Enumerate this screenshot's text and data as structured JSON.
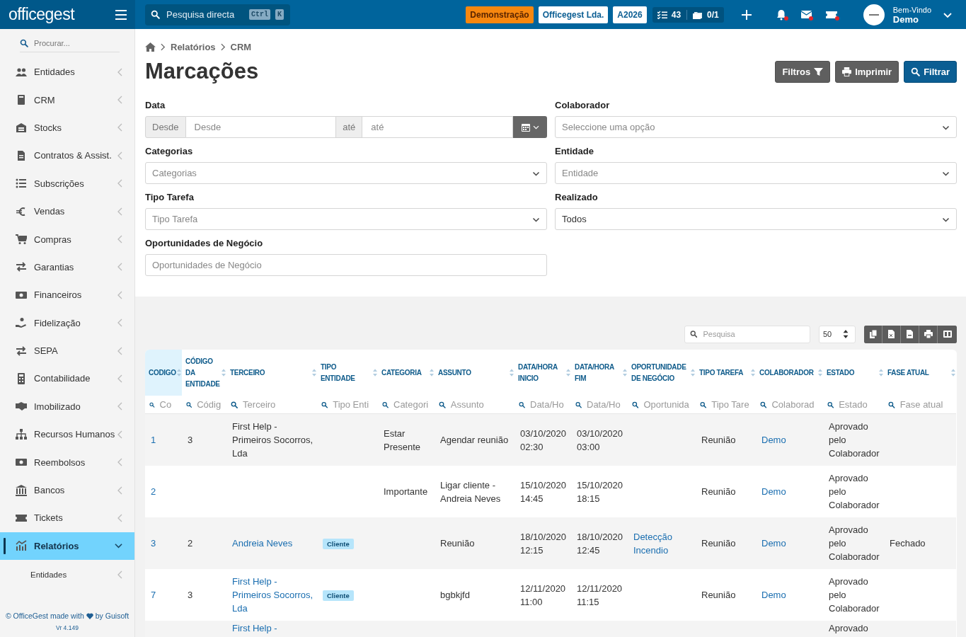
{
  "topbar": {
    "brand": "officegest",
    "search": {
      "placeholder": "Pesquisa directa",
      "keys": [
        "Ctrl",
        "K"
      ]
    },
    "badges": [
      {
        "label": "Demonstração",
        "kind": "warning"
      },
      {
        "label": "Officegest Lda.",
        "kind": "plain"
      },
      {
        "label": "A2026",
        "kind": "plain"
      }
    ],
    "counters": {
      "tasks": "43",
      "folders": "0/1"
    },
    "user": {
      "greeting": "Bem-Vindo",
      "name": "Demo"
    }
  },
  "sidebar": {
    "search": {
      "placeholder": "Procurar..."
    },
    "items": [
      {
        "label": "Entidades",
        "selected": false,
        "expanded": false
      },
      {
        "label": "CRM",
        "selected": false,
        "expanded": false
      },
      {
        "label": "Stocks",
        "selected": false,
        "expanded": false
      },
      {
        "label": "Contratos & Assist.",
        "selected": false,
        "expanded": false
      },
      {
        "label": "Subscrições",
        "selected": false,
        "expanded": false
      },
      {
        "label": "Vendas",
        "selected": false,
        "expanded": false
      },
      {
        "label": "Compras",
        "selected": false,
        "expanded": false
      },
      {
        "label": "Garantias",
        "selected": false,
        "expanded": false
      },
      {
        "label": "Financeiros",
        "selected": false,
        "expanded": false
      },
      {
        "label": "Fidelização",
        "selected": false,
        "expanded": false
      },
      {
        "label": "SEPA",
        "selected": false,
        "expanded": false
      },
      {
        "label": "Contabilidade",
        "selected": false,
        "expanded": false
      },
      {
        "label": "Imobilizado",
        "selected": false,
        "expanded": false
      },
      {
        "label": "Recursos Humanos",
        "selected": false,
        "expanded": false
      },
      {
        "label": "Reembolsos",
        "selected": false,
        "expanded": false
      },
      {
        "label": "Bancos",
        "selected": false,
        "expanded": false
      },
      {
        "label": "Tickets",
        "selected": false,
        "expanded": false
      },
      {
        "label": "Relatórios",
        "selected": true,
        "expanded": true,
        "children": [
          {
            "label": "Entidades",
            "selected": false
          }
        ]
      }
    ],
    "footer": {
      "credit": "© OfficeGest made with",
      "author": "by Guisoft",
      "version": "Vr 4.149"
    }
  },
  "breadcrumb": [
    "Relatórios",
    "CRM"
  ],
  "title": "Marcações",
  "actions": [
    {
      "label": "Filtros",
      "kind": "secondary"
    },
    {
      "label": "Imprimir",
      "kind": "secondary"
    },
    {
      "label": "Filtrar",
      "kind": "primary"
    }
  ],
  "filters": [
    {
      "kind": "daterange",
      "label": "Data",
      "from_addon": "Desde",
      "from_placeholder": "Desde",
      "to_addon": "até",
      "to_placeholder": "até"
    },
    {
      "kind": "select",
      "label": "Colaborador",
      "placeholder": "Seleccione uma opção"
    },
    {
      "kind": "select",
      "label": "Categorias",
      "placeholder": "Categorias"
    },
    {
      "kind": "select",
      "label": "Entidade",
      "placeholder": "Entidade"
    },
    {
      "kind": "select",
      "label": "Tipo Tarefa",
      "placeholder": "Tipo Tarefa"
    },
    {
      "kind": "select",
      "label": "Realizado",
      "value": "Todos"
    },
    {
      "kind": "input",
      "label": "Oportunidades de Negócio",
      "placeholder": "Oportunidades de Negócio"
    }
  ],
  "table": {
    "search": {
      "placeholder": "Pesquisa"
    },
    "page_size": "50",
    "columns": [
      {
        "label": "CODIGO",
        "placeholder": "Co",
        "selected": true
      },
      {
        "label": "CÓDIGO DA ENTIDADE",
        "placeholder": "Códig",
        "selected": false
      },
      {
        "label": "TERCEIRO",
        "placeholder": "Terceiro",
        "selected": false
      },
      {
        "label": "TIPO ENTIDADE",
        "placeholder": "Tipo Enti",
        "selected": false
      },
      {
        "label": "CATEGORIA",
        "placeholder": "Categori",
        "selected": false
      },
      {
        "label": "ASSUNTO",
        "placeholder": "Assunto",
        "selected": false
      },
      {
        "label": "DATA/HORA INICIO",
        "placeholder": "Data/Ho",
        "selected": false
      },
      {
        "label": "DATA/HORA FIM",
        "placeholder": "Data/Ho",
        "selected": false
      },
      {
        "label": "OPORTUNIDADE DE NEGÓCIO",
        "placeholder": "Oportunida",
        "selected": false
      },
      {
        "label": "TIPO TAREFA",
        "placeholder": "Tipo Tare",
        "selected": false
      },
      {
        "label": "COLABORADOR",
        "placeholder": "Colaborad",
        "selected": false
      },
      {
        "label": "ESTADO",
        "placeholder": "Estado",
        "selected": false
      },
      {
        "label": "FASE ATUAL",
        "placeholder": "Fase atual",
        "selected": false
      }
    ],
    "rows": [
      [
        {
          "kind": "link",
          "text": "1"
        },
        {
          "kind": "text",
          "text": "3"
        },
        {
          "kind": "text",
          "text": "First Help - Primeiros Socorros, Lda"
        },
        null,
        {
          "kind": "text",
          "text": "Estar Presente"
        },
        {
          "kind": "text",
          "text": "Agendar reunião"
        },
        {
          "kind": "text",
          "text": "03/10/2020 02:30"
        },
        {
          "kind": "text",
          "text": "03/10/2020 03:00"
        },
        null,
        {
          "kind": "text",
          "text": "Reunião"
        },
        {
          "kind": "link",
          "text": "Demo"
        },
        {
          "kind": "text",
          "text": "Aprovado pelo Colaborador"
        },
        null
      ],
      [
        {
          "kind": "link",
          "text": "2"
        },
        null,
        null,
        null,
        {
          "kind": "text",
          "text": "Importante"
        },
        {
          "kind": "text",
          "text": "Ligar cliente - Andreia Neves"
        },
        {
          "kind": "text",
          "text": "15/10/2020 14:45"
        },
        {
          "kind": "text",
          "text": "15/10/2020 18:15"
        },
        null,
        {
          "kind": "text",
          "text": "Reunião"
        },
        {
          "kind": "link",
          "text": "Demo"
        },
        {
          "kind": "text",
          "text": "Aprovado pelo Colaborador"
        },
        null
      ],
      [
        {
          "kind": "link",
          "text": "3"
        },
        {
          "kind": "text",
          "text": "2"
        },
        {
          "kind": "link",
          "text": "Andreia Neves"
        },
        {
          "kind": "badge",
          "text": "Cliente"
        },
        null,
        {
          "kind": "text",
          "text": "Reunião"
        },
        {
          "kind": "text",
          "text": "18/10/2020 12:15"
        },
        {
          "kind": "text",
          "text": "18/10/2020 12:45"
        },
        {
          "kind": "link",
          "text": "Detecção Incendio"
        },
        {
          "kind": "text",
          "text": "Reunião"
        },
        {
          "kind": "link",
          "text": "Demo"
        },
        {
          "kind": "text",
          "text": "Aprovado pelo Colaborador"
        },
        {
          "kind": "text",
          "text": "Fechado"
        }
      ],
      [
        {
          "kind": "link",
          "text": "7"
        },
        {
          "kind": "text",
          "text": "3"
        },
        {
          "kind": "link",
          "text": "First Help - Primeiros Socorros, Lda"
        },
        {
          "kind": "badge",
          "text": "Cliente"
        },
        null,
        {
          "kind": "text",
          "text": "bgbkjfd"
        },
        {
          "kind": "text",
          "text": "12/11/2020 11:00"
        },
        {
          "kind": "text",
          "text": "12/11/2020 11:15"
        },
        null,
        {
          "kind": "text",
          "text": "Reunião"
        },
        {
          "kind": "link",
          "text": "Demo"
        },
        {
          "kind": "text",
          "text": "Aprovado pelo Colaborador"
        },
        null
      ],
      [
        null,
        null,
        {
          "kind": "link",
          "text": "First Help -"
        },
        null,
        null,
        null,
        null,
        null,
        null,
        null,
        null,
        {
          "kind": "text",
          "text": "Aprovado"
        },
        null
      ]
    ]
  }
}
